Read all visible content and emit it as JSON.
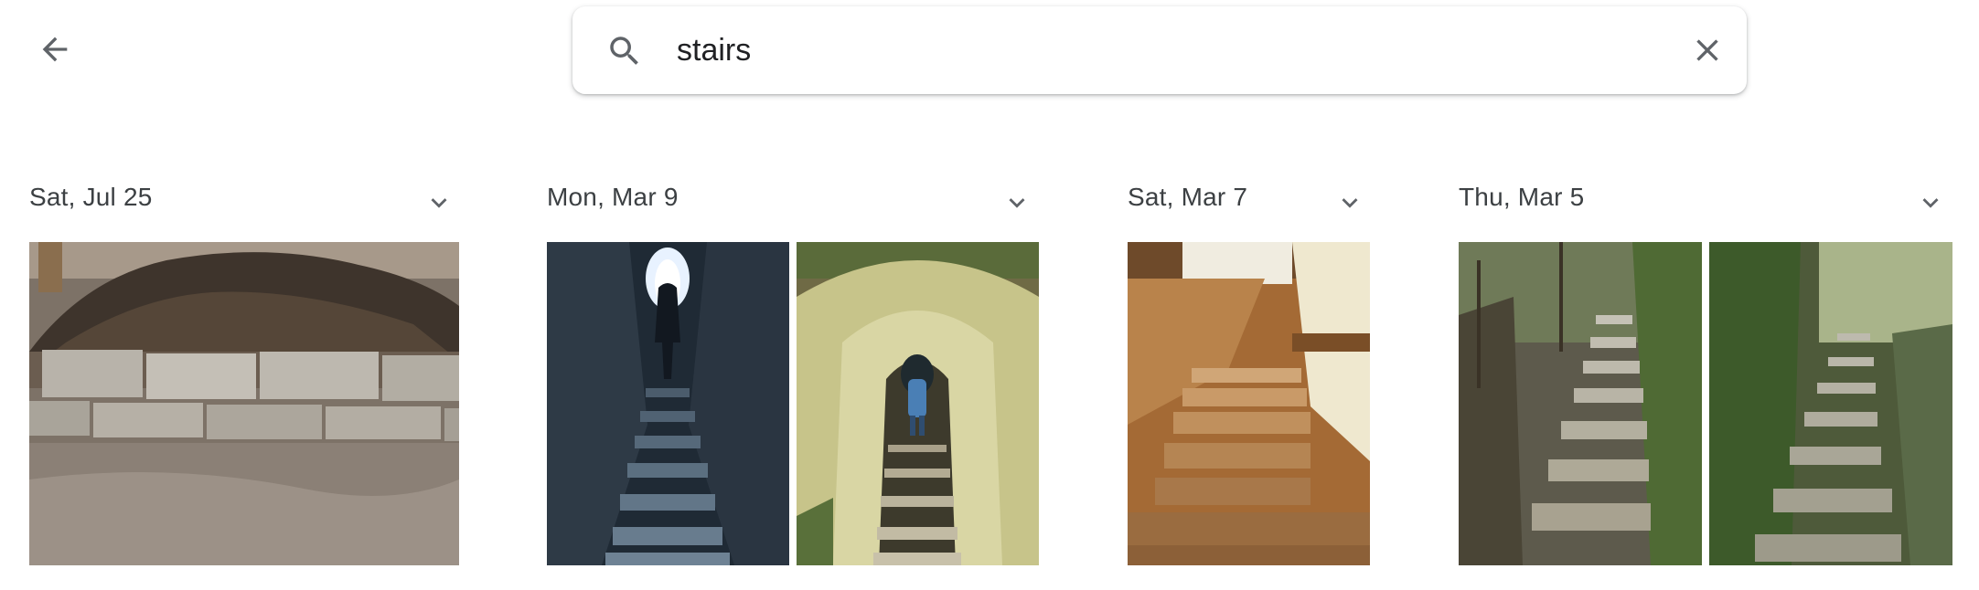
{
  "header": {
    "back_icon": "arrow-left-icon",
    "search": {
      "icon": "search-icon",
      "value": "stairs",
      "clear_icon": "close-icon"
    }
  },
  "groups": [
    {
      "date": "Sat, Jul 25",
      "photo_count": 1
    },
    {
      "date": "Mon, Mar 9",
      "photo_count": 2
    },
    {
      "date": "Sat, Mar 7",
      "photo_count": 1
    },
    {
      "date": "Thu, Mar 5",
      "photo_count": 2
    }
  ],
  "colors": {
    "icon": "#5f6368",
    "date_text": "#3c4043"
  }
}
